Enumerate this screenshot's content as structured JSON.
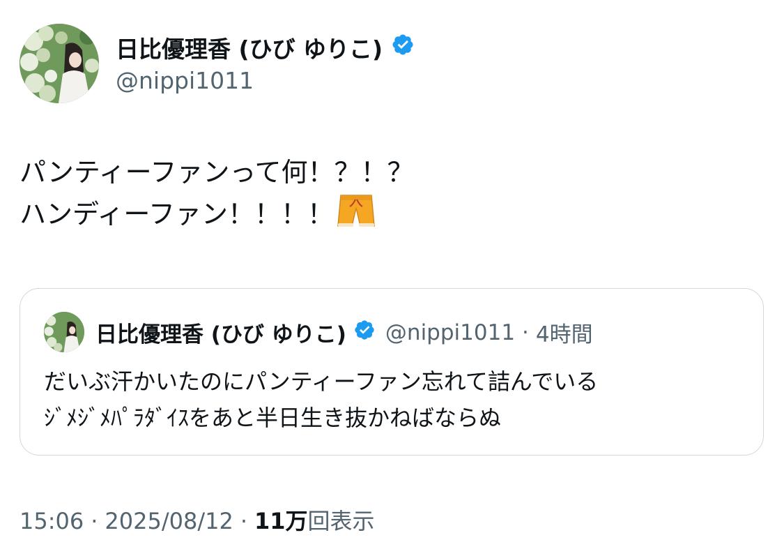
{
  "author": {
    "display_name": "日比優理香 (ひび ゆりこ)",
    "handle": "@nippi1011",
    "verified_icon": "verified-badge-icon"
  },
  "tweet": {
    "line1": "パンティーファンって何！？！？",
    "line2": "ハンディーファン！！！！",
    "emoji_icon": "shorts-icon"
  },
  "quote": {
    "display_name": "日比優理香 (ひび ゆりこ)",
    "handle": "@nippi1011",
    "separator": "·",
    "time": "4時間",
    "line1": "だいぶ汗かいたのにパンティーファン忘れて詰んでいる",
    "line2": "ｼﾞﾒｼﾞﾒﾊﾟﾗﾀﾞｲｽをあと半日生き抜かねばならぬ"
  },
  "footer": {
    "time": "15:06",
    "separator": "·",
    "date": "2025/08/12",
    "views_count": "11万",
    "views_label": "回表示"
  },
  "colors": {
    "verified_blue": "#1d9bf0",
    "secondary_text": "#536471",
    "border": "#cfd9de"
  }
}
